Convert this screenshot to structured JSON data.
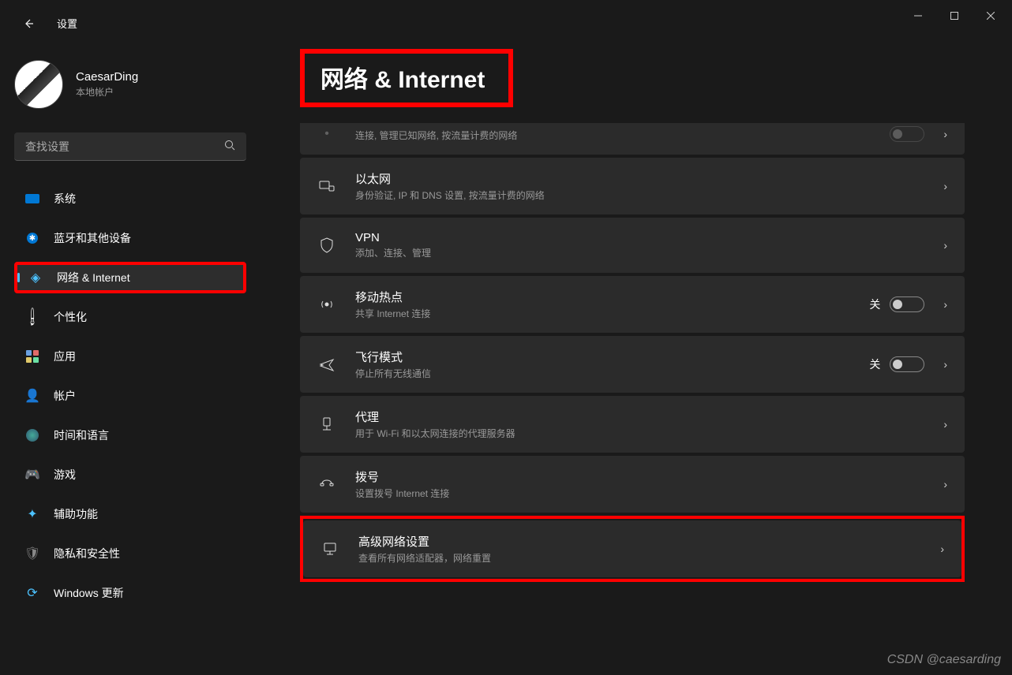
{
  "window": {
    "title": "设置"
  },
  "profile": {
    "name": "CaesarDing",
    "sub": "本地帐户"
  },
  "search": {
    "placeholder": "查找设置"
  },
  "nav": [
    {
      "id": "system",
      "label": "系统"
    },
    {
      "id": "bluetooth",
      "label": "蓝牙和其他设备"
    },
    {
      "id": "network",
      "label": "网络 & Internet",
      "active": true
    },
    {
      "id": "personalization",
      "label": "个性化"
    },
    {
      "id": "apps",
      "label": "应用"
    },
    {
      "id": "accounts",
      "label": "帐户"
    },
    {
      "id": "time",
      "label": "时间和语言"
    },
    {
      "id": "gaming",
      "label": "游戏"
    },
    {
      "id": "accessibility",
      "label": "辅助功能"
    },
    {
      "id": "privacy",
      "label": "隐私和安全性"
    },
    {
      "id": "update",
      "label": "Windows 更新"
    }
  ],
  "page": {
    "title": "网络 & Internet"
  },
  "cards": {
    "wifi_partial_sub": "连接, 管理已知网络, 按流量计费的网络",
    "ethernet": {
      "title": "以太网",
      "sub": "身份验证, IP 和 DNS 设置, 按流量计费的网络"
    },
    "vpn": {
      "title": "VPN",
      "sub": "添加、连接、管理"
    },
    "hotspot": {
      "title": "移动热点",
      "sub": "共享 Internet 连接",
      "toggle": "关"
    },
    "airplane": {
      "title": "飞行模式",
      "sub": "停止所有无线通信",
      "toggle": "关"
    },
    "proxy": {
      "title": "代理",
      "sub": "用于 Wi-Fi 和以太网连接的代理服务器"
    },
    "dialup": {
      "title": "拨号",
      "sub": "设置拨号 Internet 连接"
    },
    "advanced": {
      "title": "高级网络设置",
      "sub": "查看所有网络适配器，网络重置"
    }
  },
  "watermark": "CSDN @caesarding"
}
